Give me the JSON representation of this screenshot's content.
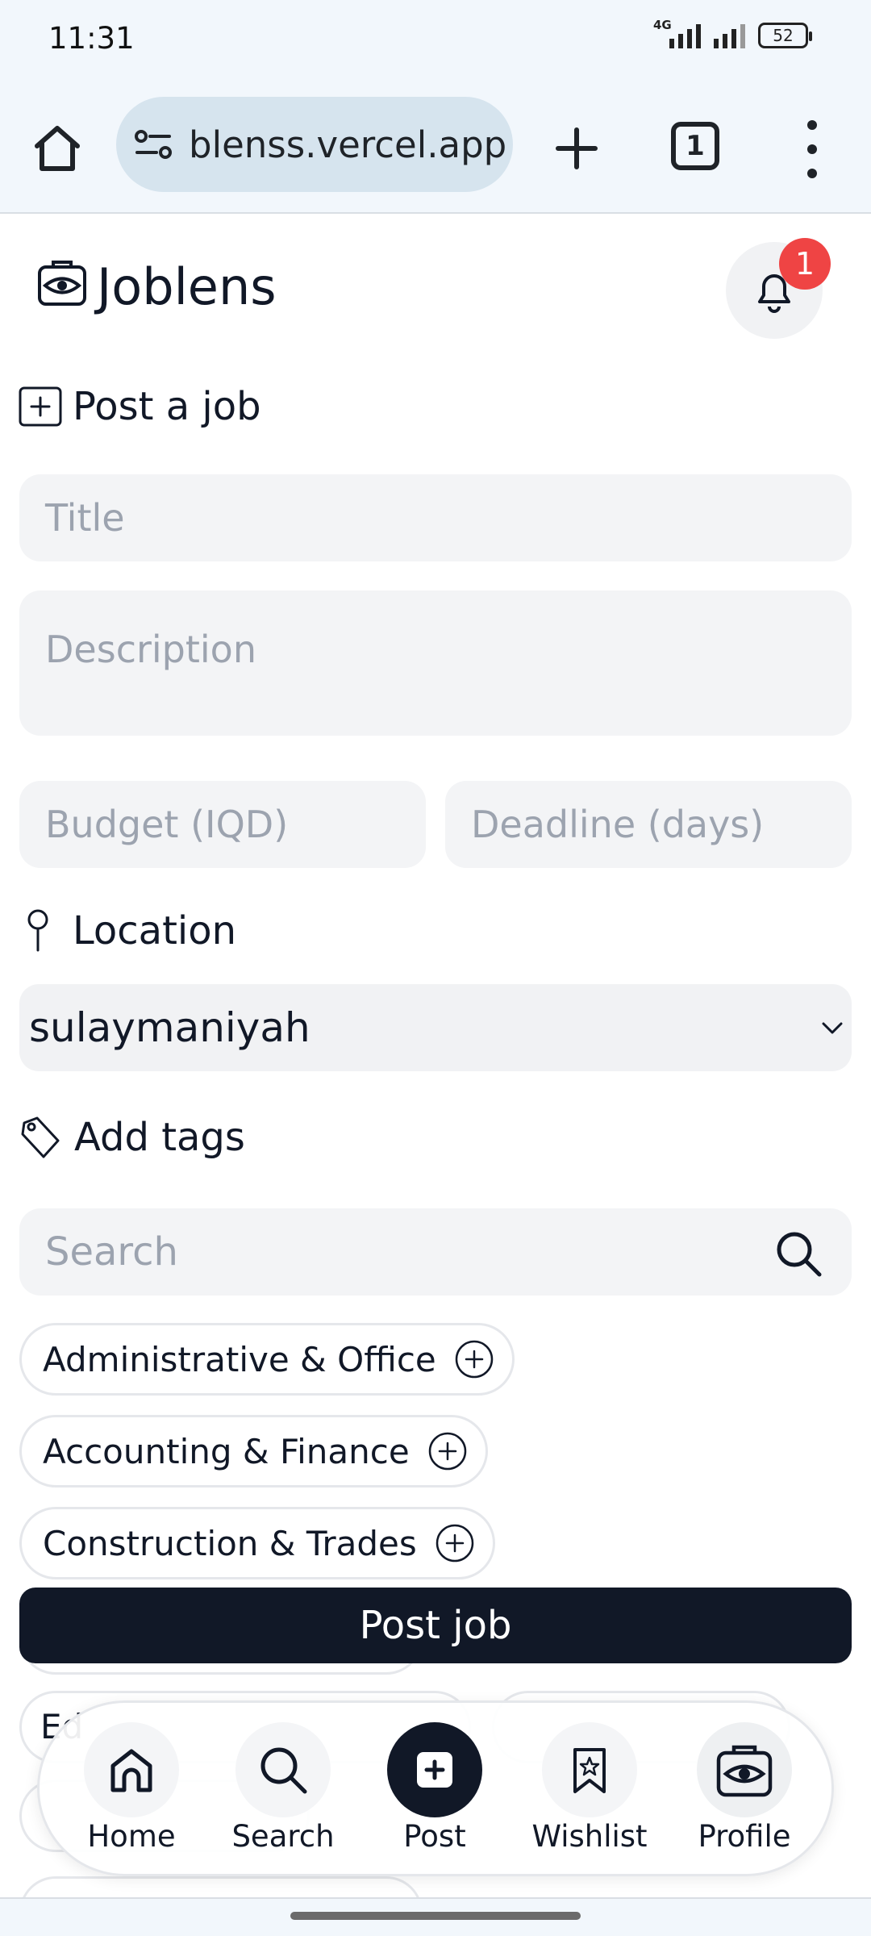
{
  "status_bar": {
    "time": "11:31",
    "network": "4G",
    "battery": "52"
  },
  "browser": {
    "url": "blenss.vercel.app",
    "tab_count": "1"
  },
  "app": {
    "title": "Joblens",
    "notification_count": "1"
  },
  "form": {
    "section_title": "Post a job",
    "title_placeholder": "Title",
    "description_placeholder": "Description",
    "budget_placeholder": "Budget (IQD)",
    "deadline_placeholder": "Deadline (days)",
    "location_label": "Location",
    "location_value": "sulaymaniyah",
    "tags_label": "Add tags",
    "search_placeholder": "Search",
    "tags": [
      "Administrative & Office",
      "Accounting & Finance",
      "Construction & Trades"
    ],
    "partial_tag_text": "Ed",
    "submit_label": "Post job"
  },
  "bottom_nav": {
    "items": [
      {
        "label": "Home",
        "icon": "home-icon"
      },
      {
        "label": "Search",
        "icon": "search-icon"
      },
      {
        "label": "Post",
        "icon": "plus-square-icon"
      },
      {
        "label": "Wishlist",
        "icon": "bookmark-star-icon"
      },
      {
        "label": "Profile",
        "icon": "eye-bag-icon"
      }
    ],
    "active": "Post"
  },
  "colors": {
    "primary_dark": "#111827",
    "badge_red": "#ef4444",
    "input_bg": "#f3f4f6",
    "chrome_bg": "#f2f7fc"
  }
}
